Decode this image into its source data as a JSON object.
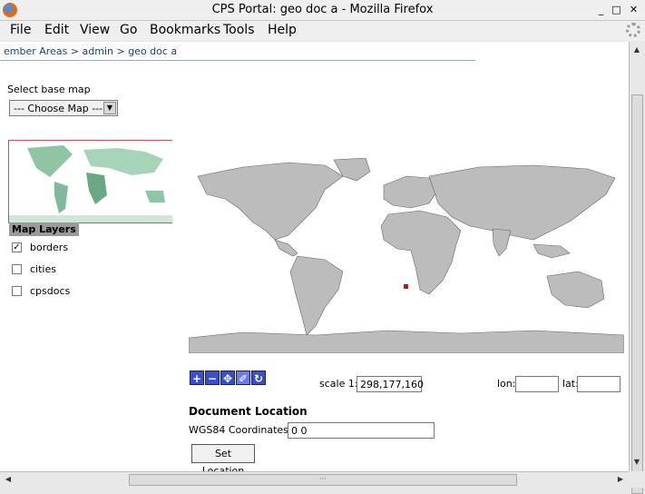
{
  "window": {
    "title": "CPS Portal: geo doc a - Mozilla Firefox"
  },
  "menu": [
    "File",
    "Edit",
    "View",
    "Go",
    "Bookmarks",
    "Tools",
    "Help"
  ],
  "breadcrumb": [
    "ember Areas",
    "admin",
    "geo doc a"
  ],
  "base_map": {
    "label": "Select base map",
    "selected": "--- Choose Map ---"
  },
  "layers": {
    "title": "Map Layers",
    "items": [
      {
        "label": "borders",
        "checked": true
      },
      {
        "label": "cities",
        "checked": false
      },
      {
        "label": "cpsdocs",
        "checked": false
      }
    ]
  },
  "toolbar": {
    "tools": [
      "zoom-in-icon",
      "zoom-out-icon",
      "pan-icon",
      "select-icon",
      "refresh-icon"
    ]
  },
  "scale": {
    "label": "scale 1:",
    "value": "298,177,160"
  },
  "coords": {
    "lon_label": "lon:",
    "lon_value": "",
    "lat_label": "lat:",
    "lat_value": ""
  },
  "document": {
    "title": "Document Location",
    "wgs_label": "WGS84 Coordinates:",
    "wgs_value": "0 0",
    "set_button": "Set Location"
  },
  "colors": {
    "land": "#bcbcbc",
    "overview_land": "#7fb89a",
    "marker": "#cc1111",
    "tool": "#3a4fd0"
  }
}
